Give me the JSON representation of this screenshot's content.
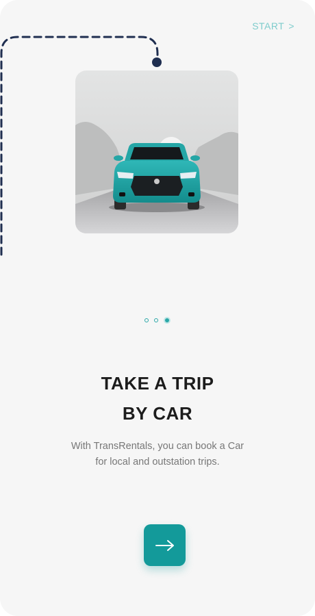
{
  "header": {
    "start_label": "START",
    "start_chevron": ">"
  },
  "onboarding": {
    "title_line1": "TAKE A TRIP",
    "title_line2": "BY CAR",
    "desc_line1": "With TransRentals, you can book a Car",
    "desc_line2": "for local and outstation trips.",
    "active_page": 3,
    "total_pages": 3
  },
  "icons": {
    "next": "arrow-right-icon",
    "illustration": "car-illustration"
  },
  "colors": {
    "accent": "#139a9a",
    "start_text": "#7ecccc",
    "dash": "#1f2e50",
    "background": "#f6f6f6"
  }
}
